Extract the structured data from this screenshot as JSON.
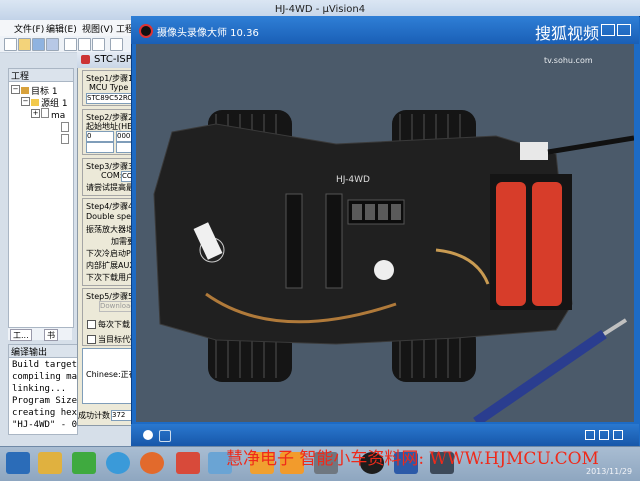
{
  "uvision": {
    "title": "HJ-4WD - µVision4",
    "menus": [
      "文件(F)",
      "编辑(E)",
      "视图(V)",
      "工程"
    ],
    "project_panel": {
      "header": "工程",
      "tree": [
        "目标 1",
        "源组 1",
        "ma"
      ],
      "tabs": [
        "工...",
        "书"
      ]
    },
    "build_output": {
      "header": "编译输出",
      "lines": [
        "Build target",
        "compiling ma",
        "linking...",
        "Program Size",
        "creating hex",
        "\"HJ-4WD\" - 0"
      ]
    }
  },
  "stc_isp": {
    "title": "STC-ISP",
    "step1_label": "Step1/步骤1:",
    "mcu_type_label": "MCU Type",
    "mcu_type_value": "STC89C52RC",
    "step2_label": "Step2/步骤2:",
    "start_addr_label": "起始地址(HEX)",
    "addr_value_1": "0",
    "addr_value_2": "000",
    "step3_label": "Step3/步骤3:",
    "com_label": "COM:",
    "com_value": "COM",
    "step3_note": "请尝试提高最",
    "step4_label": "Step4/步骤4:",
    "step4_lines": [
      "Double speed",
      "振荡放大器增",
      "加需要",
      "下次冷启动P1",
      "内部扩展AUX-",
      "下次下载用户"
    ],
    "step5_label": "Step5/步骤5:",
    "download_button": "Download",
    "checkbox1_label": "每次下载",
    "checkbox2_label": "当目标代码",
    "status_text": "Chinese:正在",
    "success_count_label": "成功计数",
    "success_count_value": "372"
  },
  "video_player": {
    "title": "摄像头录像大师 10.36",
    "sohu_logo": "搜狐视频",
    "sohu_url": "tv.sohu.com",
    "board_label": "HJ-4WD"
  },
  "watermark": "慧净电子 智能小车资料网: WWW.HJMCU.COM",
  "taskbar": {
    "date": "2013/11/29"
  }
}
